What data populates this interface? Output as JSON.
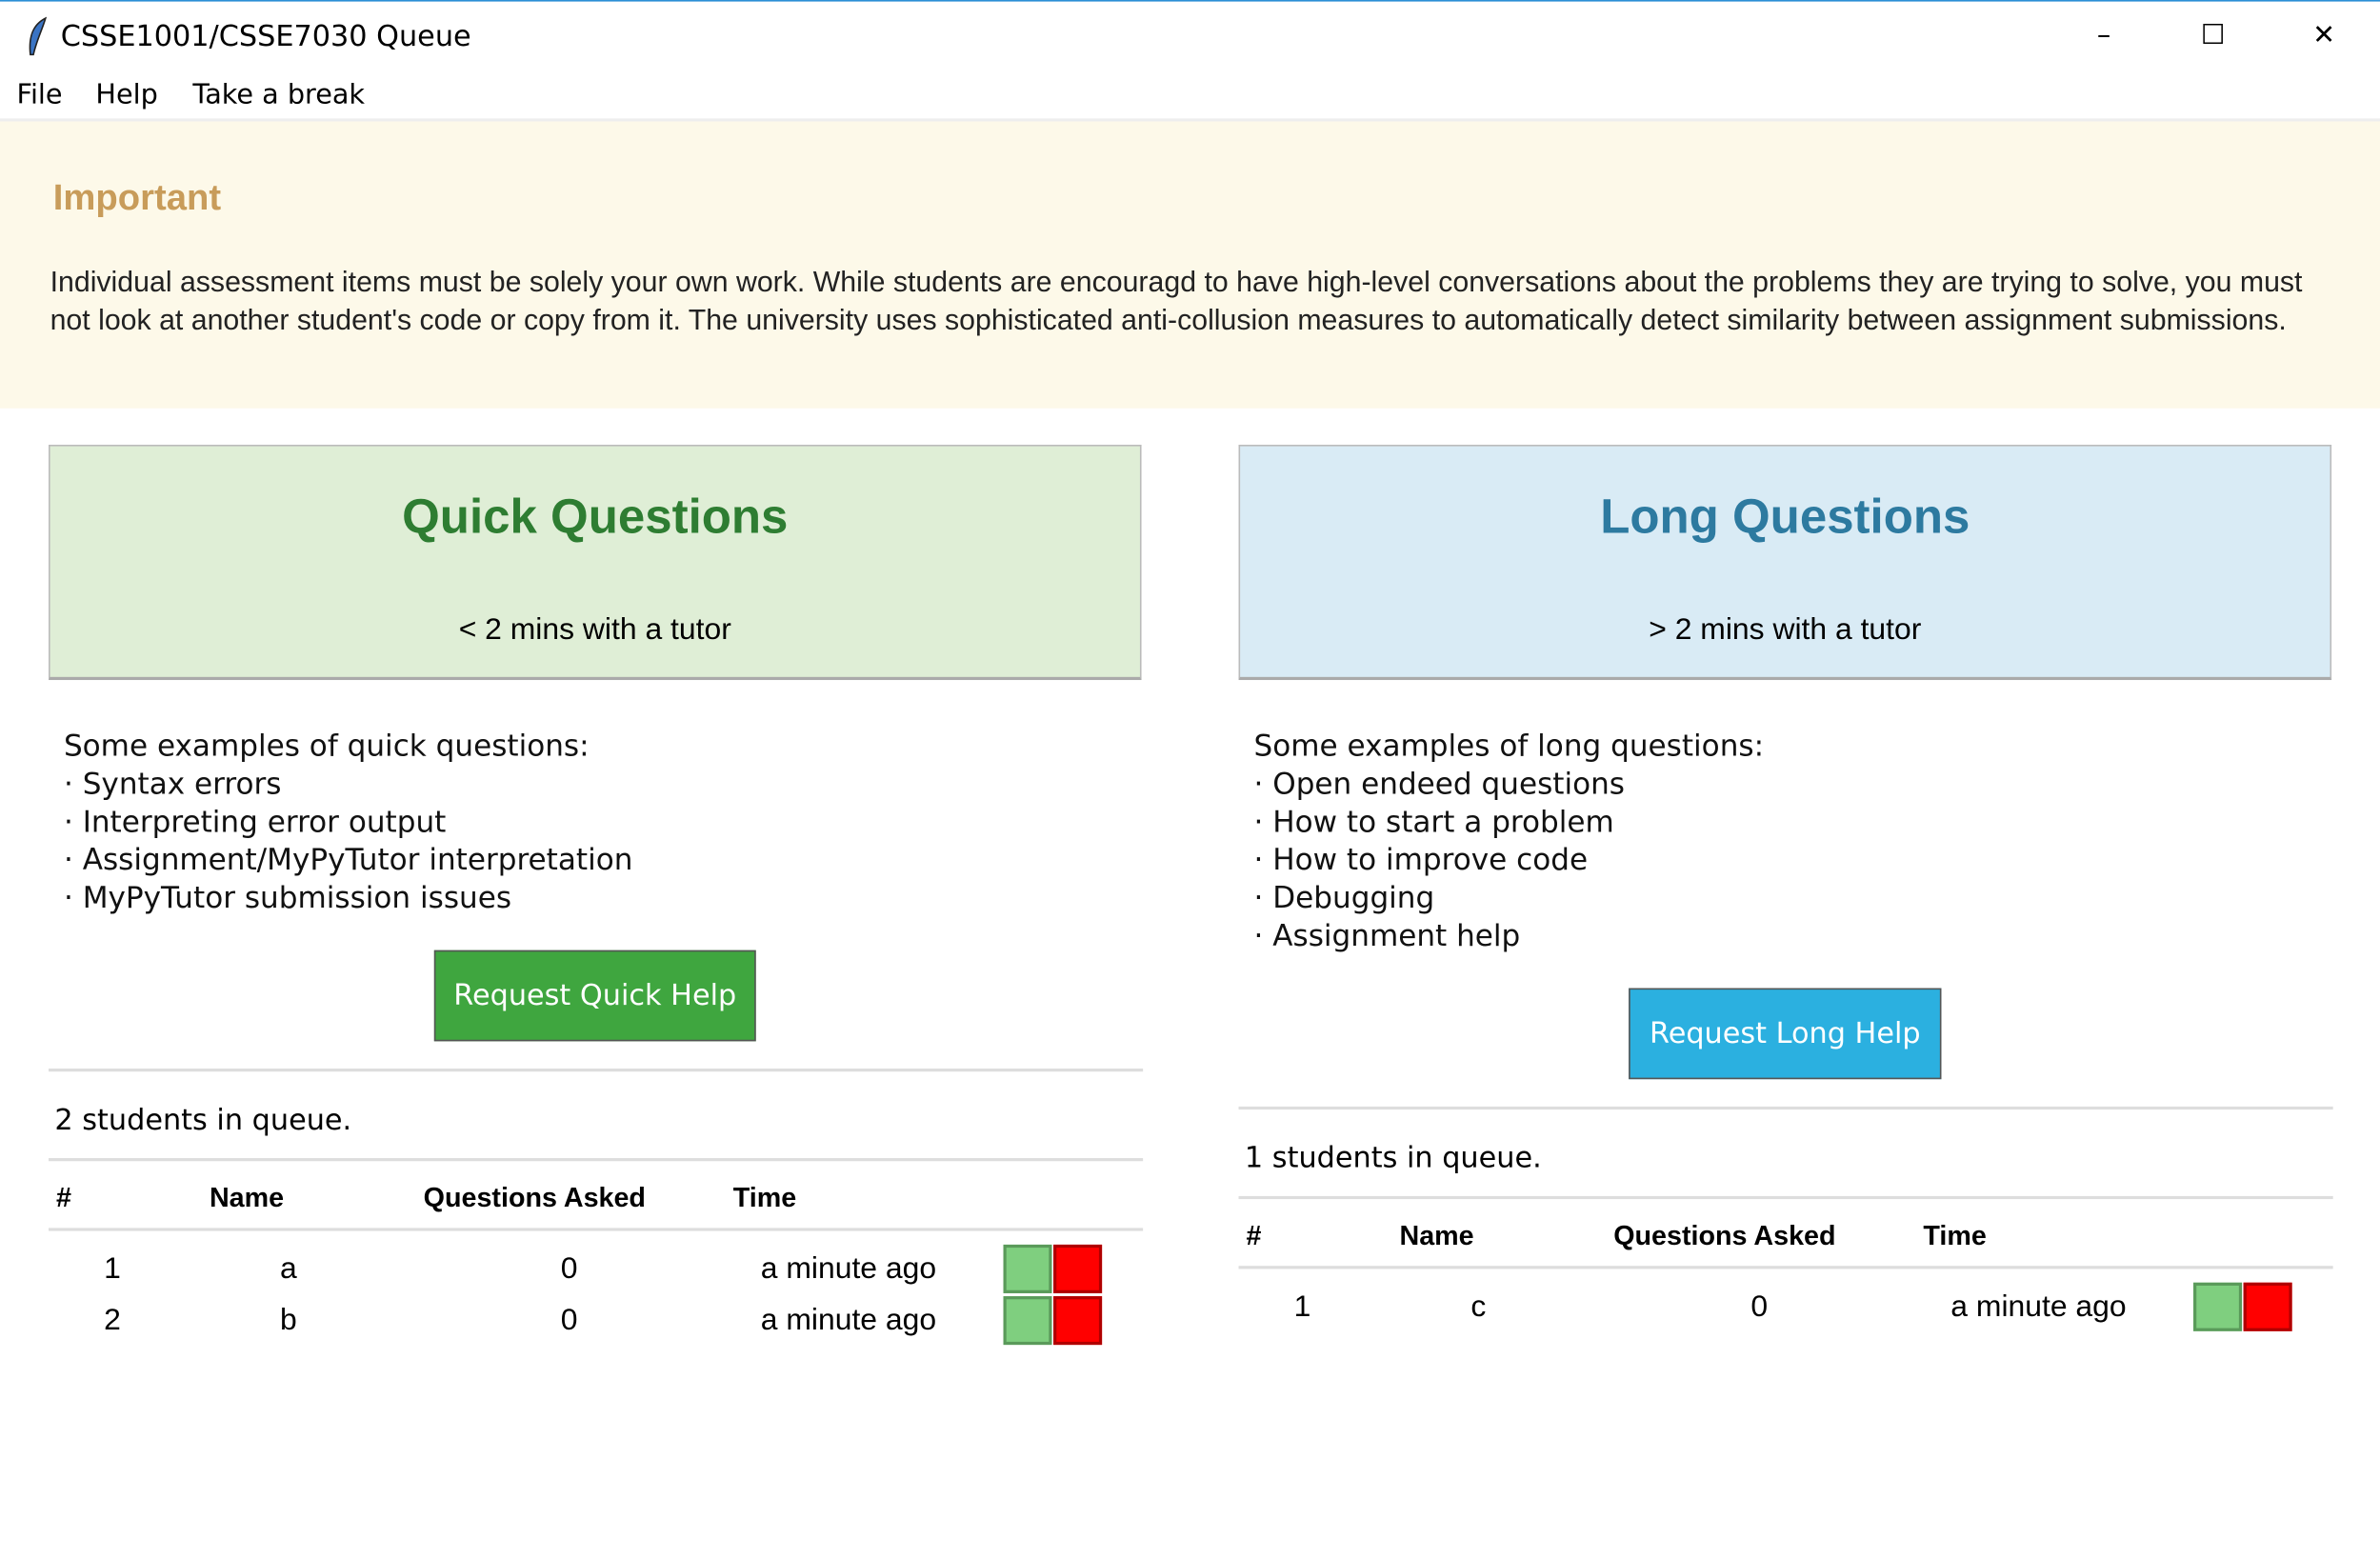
{
  "window": {
    "title": "CSSE1001/CSSE7030 Queue",
    "icon": "feather-icon",
    "minimize": "–",
    "maximize": "☐",
    "close": "✕"
  },
  "menu": [
    "File",
    "Help",
    "Take a break"
  ],
  "important": {
    "title": "Important",
    "text": "Individual assessment items must be solely your own work. While students are encouragd to have high-level conversations about the problems they are trying to solve, you must not look at another student's code or copy from it. The university uses sophisticated anti-collusion measures to automatically detect similarity between assignment submissions."
  },
  "quick": {
    "title": "Quick Questions",
    "subtitle": "< 2 mins with a tutor",
    "color": "#2e7d32",
    "bg": "#dfeed6",
    "examples_intro": "Some examples of quick questions:",
    "examples": [
      "· Syntax errors",
      "· Interpreting error output",
      "· Assignment/MyPyTutor interpretation",
      "· MyPyTutor submission issues"
    ],
    "button": "Request Quick Help",
    "button_color": "#3fa63f",
    "queue_count": "2 students in queue.",
    "columns": [
      "#",
      "Name",
      "Questions Asked",
      "Time"
    ],
    "rows": [
      {
        "n": "1",
        "name": "a",
        "asked": "0",
        "time": "a minute ago"
      },
      {
        "n": "2",
        "name": "b",
        "asked": "0",
        "time": "a minute ago"
      }
    ]
  },
  "long": {
    "title": "Long Questions",
    "subtitle": "> 2 mins with a tutor",
    "color": "#2d7aa0",
    "bg": "#d9ebf5",
    "examples_intro": "Some examples of long questions:",
    "examples": [
      "· Open endeed questions",
      "· How to start a problem",
      "· How to improve code",
      "· Debugging",
      "· Assignment help"
    ],
    "button": "Request Long Help",
    "button_color": "#2bb0e0",
    "queue_count": "1 students in queue.",
    "columns": [
      "#",
      "Name",
      "Questions Asked",
      "Time"
    ],
    "rows": [
      {
        "n": "1",
        "name": "c",
        "asked": "0",
        "time": "a minute ago"
      }
    ]
  }
}
